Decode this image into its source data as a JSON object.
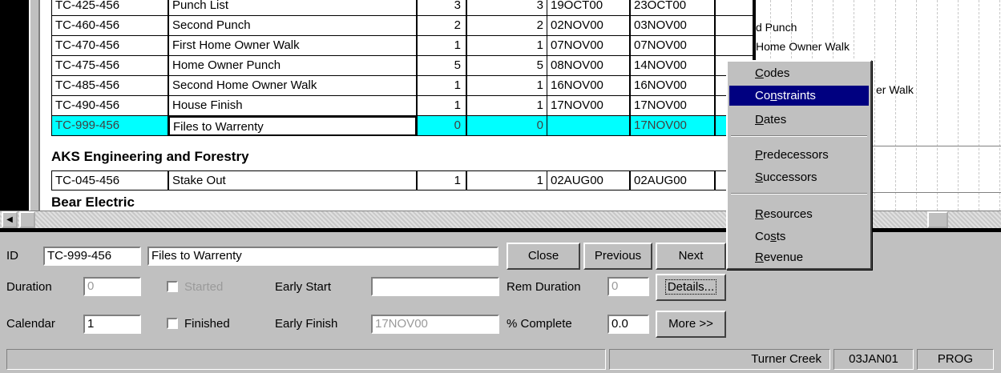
{
  "table": {
    "rows": [
      {
        "id": "TC-425-456",
        "name": "Punch List",
        "dur": "3",
        "rem": "3",
        "start": "19OCT00",
        "finish": "23OCT00"
      },
      {
        "id": "TC-460-456",
        "name": "Second Punch",
        "dur": "2",
        "rem": "2",
        "start": "02NOV00",
        "finish": "03NOV00"
      },
      {
        "id": "TC-470-456",
        "name": "First Home Owner Walk",
        "dur": "1",
        "rem": "1",
        "start": "07NOV00",
        "finish": "07NOV00"
      },
      {
        "id": "TC-475-456",
        "name": "Home Owner Punch",
        "dur": "5",
        "rem": "5",
        "start": "08NOV00",
        "finish": "14NOV00"
      },
      {
        "id": "TC-485-456",
        "name": "Second Home Owner Walk",
        "dur": "1",
        "rem": "1",
        "start": "16NOV00",
        "finish": "16NOV00"
      },
      {
        "id": "TC-490-456",
        "name": "House Finish",
        "dur": "1",
        "rem": "1",
        "start": "17NOV00",
        "finish": "17NOV00"
      },
      {
        "id": "TC-999-456",
        "name": "Files to Warrenty",
        "dur": "0",
        "rem": "0",
        "start": "",
        "finish": "17NOV00"
      }
    ],
    "group1": "AKS Engineering and Forestry",
    "group1_rows": [
      {
        "id": "TC-045-456",
        "name": "Stake Out",
        "dur": "1",
        "rem": "1",
        "start": "02AUG00",
        "finish": "02AUG00"
      }
    ],
    "group2": "Bear Electric"
  },
  "gantt": {
    "labels": [
      "d Punch",
      "Home Owner Walk",
      "er Walk"
    ]
  },
  "menu": {
    "items": [
      "Codes",
      "Constraints",
      "Dates",
      "Predecessors",
      "Successors",
      "Resources",
      "Costs",
      "Revenue"
    ],
    "selected": "Constraints"
  },
  "form": {
    "id_label": "ID",
    "id_value": "TC-999-456",
    "name_value": "Files to Warrenty",
    "close": "Close",
    "previous": "Previous",
    "next": "Next",
    "duration_label": "Duration",
    "duration_value": "0",
    "started_label": "Started",
    "early_start_label": "Early Start",
    "early_start_value": "",
    "rem_duration_label": "Rem Duration",
    "rem_duration_value": "0",
    "details": "Details...",
    "calendar_label": "Calendar",
    "calendar_value": "1",
    "finished_label": "Finished",
    "early_finish_label": "Early Finish",
    "early_finish_value": "17NOV00",
    "pct_complete_label": "% Complete",
    "pct_complete_value": "0.0",
    "more": "More >>"
  },
  "status": {
    "project": "Turner Creek",
    "date": "03JAN01",
    "mode": "PROG"
  }
}
